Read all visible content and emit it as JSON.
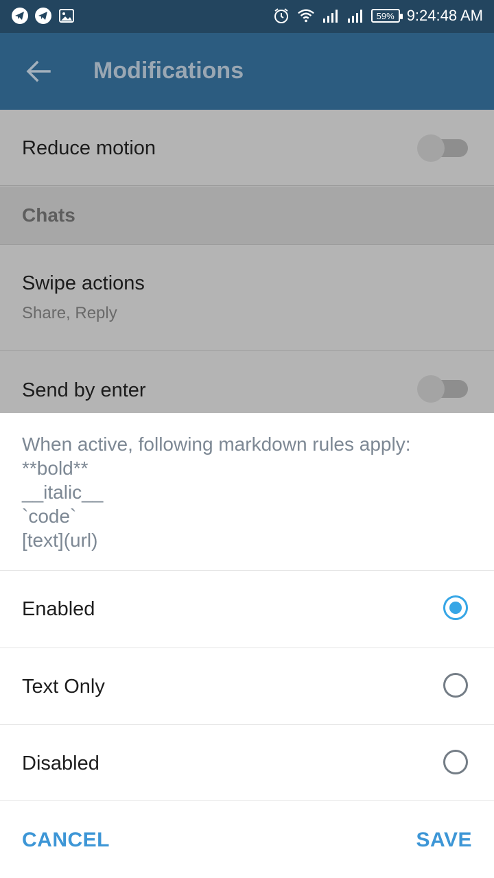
{
  "status_bar": {
    "left_icons": [
      "telegram-icon",
      "telegram-icon",
      "image-icon"
    ],
    "right_icons": [
      "alarm-icon",
      "wifi-icon",
      "signal-icon",
      "signal-icon"
    ],
    "battery": "59%",
    "time": "9:24:48 AM"
  },
  "appbar": {
    "back_icon": "arrow-left-icon",
    "title": "Modifications"
  },
  "list": {
    "reduce_motion": {
      "label": "Reduce motion",
      "enabled": false
    },
    "section_chats": "Chats",
    "swipe_actions": {
      "label": "Swipe actions",
      "value": "Share, Reply"
    },
    "send_by_enter": {
      "label": "Send by enter",
      "enabled": false
    }
  },
  "dialog": {
    "description_lines": [
      "When active, following markdown rules apply:",
      "**bold**",
      "__italic__",
      "`code`",
      "[text](url)"
    ],
    "options": [
      {
        "label": "Enabled",
        "selected": true
      },
      {
        "label": "Text Only",
        "selected": false
      },
      {
        "label": "Disabled",
        "selected": false
      }
    ],
    "cancel_label": "CANCEL",
    "save_label": "SAVE"
  },
  "colors": {
    "status_bar": "#23455f",
    "app_bar": "#2c5c80",
    "accent": "#36a6e6",
    "button_text": "#3d96d6"
  }
}
